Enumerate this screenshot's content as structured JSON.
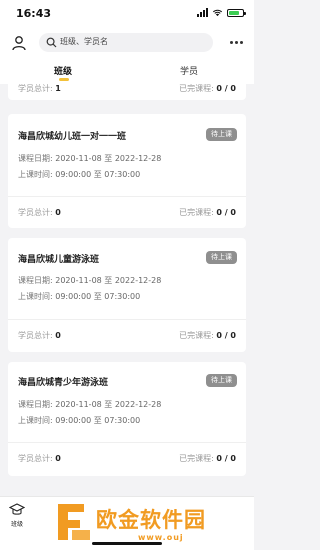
{
  "status_bar": {
    "time": "16:43"
  },
  "search": {
    "placeholder": "班级、学员名"
  },
  "tabs": [
    {
      "label": "班级",
      "active": true
    },
    {
      "label": "学员",
      "active": false
    }
  ],
  "labels": {
    "student_total": "学员总计:",
    "completed": "已完课程:",
    "course_date": "课程日期:",
    "class_time": "上课时间:",
    "to_label": "至"
  },
  "partial_card": {
    "student_total": "1",
    "completed": "0 / 0"
  },
  "cards": [
    {
      "title": "海昌欣城幼儿班一对一一班",
      "badge": "待上课",
      "date_start": "2020-11-08",
      "date_end": "2022-12-28",
      "time_start": "09:00:00",
      "time_end": "07:30:00",
      "student_total": "0",
      "completed": "0 / 0"
    },
    {
      "title": "海昌欣城儿童游泳班",
      "badge": "待上课",
      "date_start": "2020-11-08",
      "date_end": "2022-12-28",
      "time_start": "09:00:00",
      "time_end": "07:30:00",
      "student_total": "0",
      "completed": "0 / 0"
    },
    {
      "title": "海昌欣城青少年游泳班",
      "badge": "待上课",
      "date_start": "2020-11-08",
      "date_end": "2022-12-28",
      "time_start": "09:00:00",
      "time_end": "07:30:00",
      "student_total": "0",
      "completed": "0 / 0"
    }
  ],
  "bottom_tabs": [
    {
      "label": "班级",
      "icon": "graduation-cap-icon"
    }
  ],
  "watermark": {
    "text": "欧金软件园",
    "url": "www.ouj"
  },
  "colors": {
    "accent": "#f3c13a",
    "badge": "#8f8f8f",
    "watermark": "#f19b22"
  }
}
